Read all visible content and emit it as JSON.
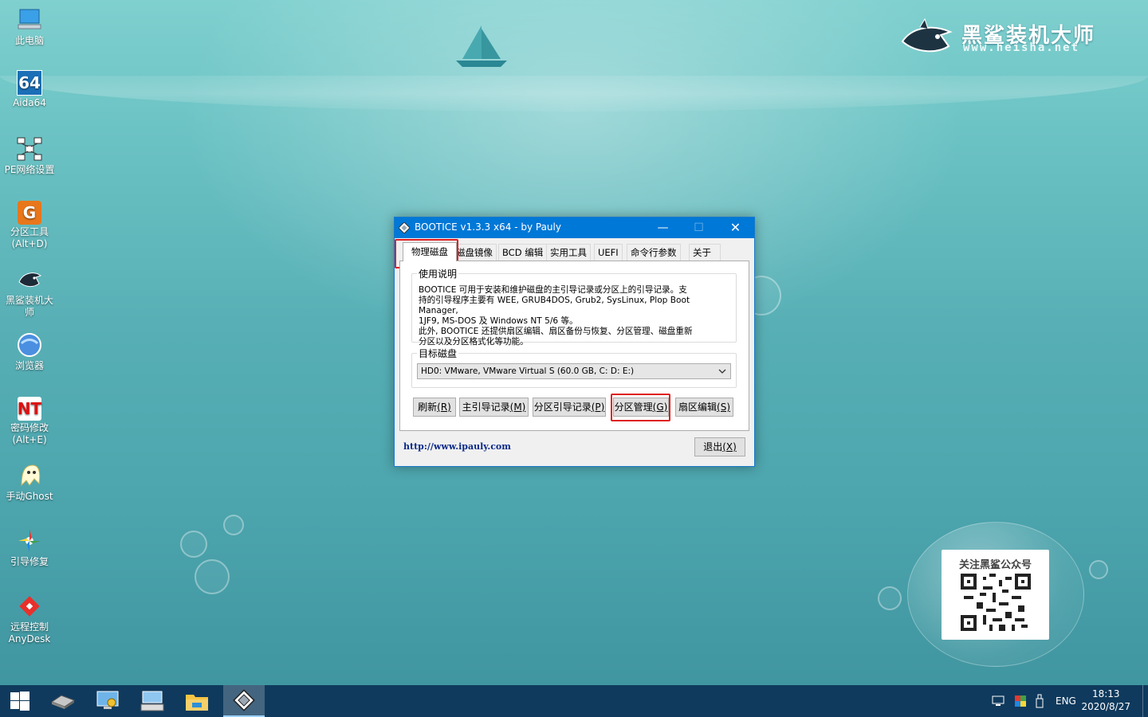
{
  "desktop": {
    "icons": [
      {
        "label": "此电脑",
        "icon": "computer-icon"
      },
      {
        "label": "Aida64",
        "icon": "aida64-icon",
        "badge": "64"
      },
      {
        "label": "PE网络设置",
        "icon": "network-icon"
      },
      {
        "label": "分区工具\n(Alt+D)",
        "icon": "partition-tool-icon",
        "badge": "G"
      },
      {
        "label": "黑鲨装机大师",
        "icon": "shark-icon"
      },
      {
        "label": "浏览器",
        "icon": "browser-icon"
      },
      {
        "label": "密码修改\n(Alt+E)",
        "icon": "password-icon",
        "badge": "NT"
      },
      {
        "label": "手动Ghost",
        "icon": "ghost-icon"
      },
      {
        "label": "引导修复",
        "icon": "boot-repair-icon"
      },
      {
        "label": "远程控制\nAnyDesk",
        "icon": "anydesk-icon"
      }
    ],
    "brand": {
      "name": "黑鲨装机大师",
      "url": "www.heisha.net"
    },
    "qr": {
      "title": "关注黑鲨公众号"
    }
  },
  "window": {
    "title": "BOOTICE v1.3.3 x64 - by Pauly",
    "controls": {
      "minimize": "—",
      "maximize": "☐",
      "close": "✕"
    },
    "tabs": [
      "物理磁盘",
      "磁盘镜像",
      "BCD 编辑",
      "实用工具",
      "UEFI",
      "命令行参数",
      "关于"
    ],
    "active_tab": "物理磁盘",
    "usage": {
      "label": "使用说明",
      "text": "BOOTICE 可用于安装和维护磁盘的主引导记录或分区上的引导记录。支\n持的引导程序主要有 WEE, GRUB4DOS, Grub2, SysLinux, Plop Boot Manager,\n1JF9, MS-DOS 及 Windows NT 5/6 等。\n此外, BOOTICE 还提供扇区编辑、扇区备份与恢复、分区管理、磁盘重新\n分区以及分区格式化等功能。"
    },
    "target": {
      "label": "目标磁盘",
      "selected": "HD0: VMware, VMware Virtual S (60.0 GB, C: D: E:)"
    },
    "buttons": {
      "refresh": {
        "text": "刷新",
        "key": "(R)"
      },
      "mbr": {
        "text": "主引导记录",
        "key": "(M)"
      },
      "pbr": {
        "text": "分区引导记录",
        "key": "(P)"
      },
      "parts": {
        "text": "分区管理",
        "key": "(G)"
      },
      "sector": {
        "text": "扇区编辑",
        "key": "(S)"
      },
      "exit": {
        "text": "退出",
        "key": "(X)"
      }
    },
    "link": "http://www.ipauly.com"
  },
  "taskbar": {
    "items": [
      "start-icon",
      "drive-icon",
      "computer-settings-icon",
      "keyboard-icon",
      "file-explorer-icon",
      "bootice-icon"
    ],
    "lang": "ENG",
    "time": "18:13",
    "date": "2020/8/27"
  }
}
